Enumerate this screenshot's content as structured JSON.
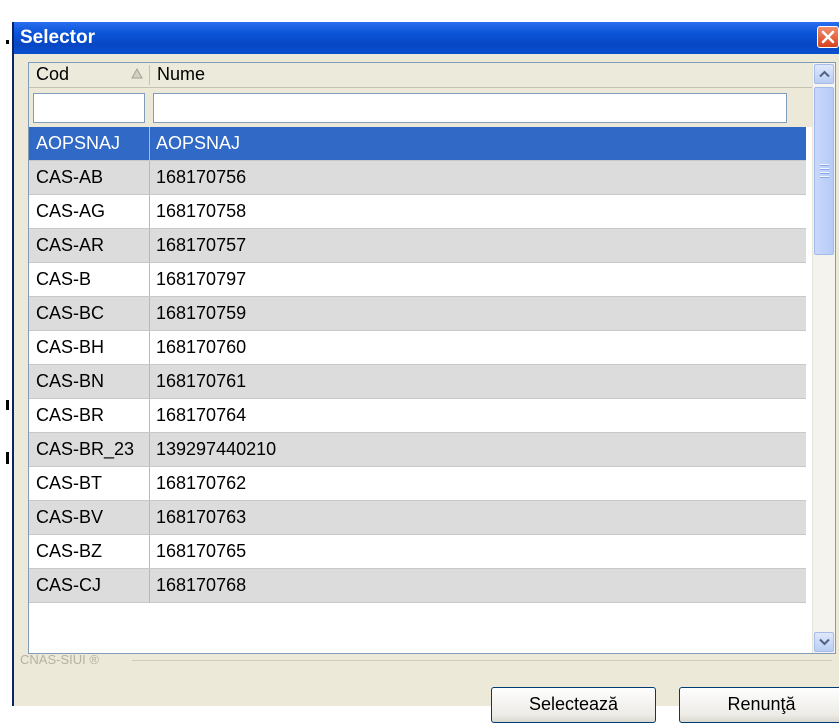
{
  "window": {
    "title": "Selector"
  },
  "columns": {
    "cod": "Cod",
    "nume": "Nume"
  },
  "filters": {
    "cod": "",
    "nume": ""
  },
  "rows": [
    {
      "cod": "AOPSNAJ",
      "nume": "AOPSNAJ",
      "selected": true
    },
    {
      "cod": "CAS-AB",
      "nume": "168170756"
    },
    {
      "cod": "CAS-AG",
      "nume": "168170758"
    },
    {
      "cod": "CAS-AR",
      "nume": "168170757"
    },
    {
      "cod": "CAS-B",
      "nume": "168170797"
    },
    {
      "cod": "CAS-BC",
      "nume": "168170759"
    },
    {
      "cod": "CAS-BH",
      "nume": "168170760"
    },
    {
      "cod": "CAS-BN",
      "nume": "168170761"
    },
    {
      "cod": "CAS-BR",
      "nume": "168170764"
    },
    {
      "cod": "CAS-BR_23",
      "nume": "139297440210"
    },
    {
      "cod": "CAS-BT",
      "nume": "168170762"
    },
    {
      "cod": "CAS-BV",
      "nume": "168170763"
    },
    {
      "cod": "CAS-BZ",
      "nume": "168170765"
    },
    {
      "cod": "CAS-CJ",
      "nume": "168170768"
    }
  ],
  "footer": {
    "label": "CNAS-SIUI ®"
  },
  "buttons": {
    "select": "Selectează",
    "cancel": "Renunţă"
  },
  "icons": {
    "close": "close-icon",
    "sort": "sort-ascending-icon",
    "scroll_up": "arrow-up-icon",
    "scroll_down": "arrow-down-icon"
  },
  "colors": {
    "title_bar": "#0a55d8",
    "selection": "#3169c6",
    "alt_row": "#dcdcdc",
    "dialog_bg": "#ece9d8",
    "close": "#d7421f"
  }
}
